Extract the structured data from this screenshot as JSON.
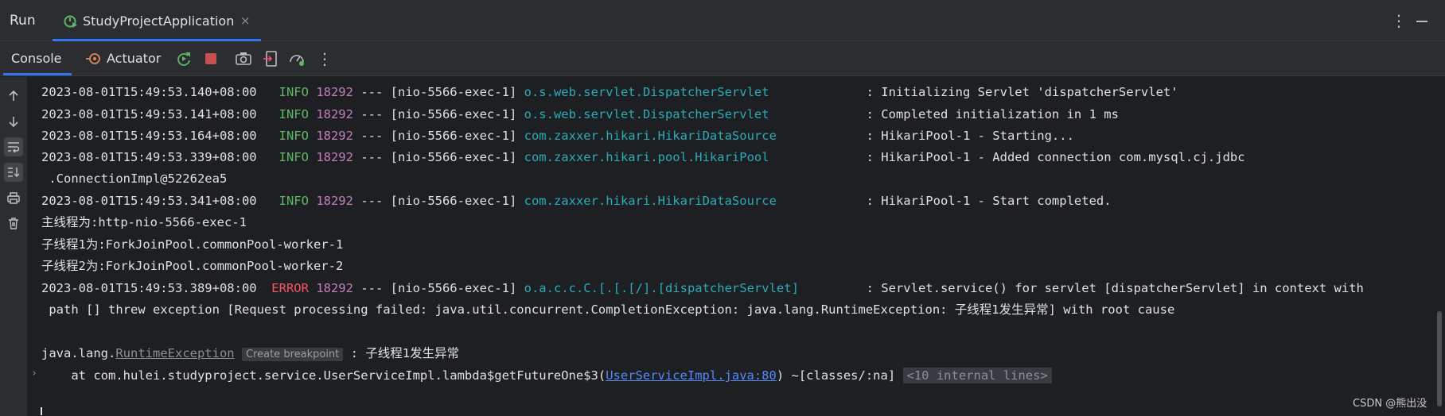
{
  "window": {
    "title": "Run",
    "tab": {
      "label": "StudyProjectApplication",
      "close": "×"
    },
    "more": "⋮"
  },
  "toolbar": {
    "console_label": "Console",
    "actuator_label": "Actuator",
    "more": "⋮"
  },
  "console": {
    "lines": [
      {
        "ts": "2023-08-01T15:49:53.140+08:00",
        "level": " INFO",
        "pid": "18292",
        "sep": " --- ",
        "thread": "[nio-5566-exec-1]",
        "logger": "o.s.web.servlet.DispatcherServlet",
        "msg": ": Initializing Servlet 'dispatcherServlet'"
      },
      {
        "ts": "2023-08-01T15:49:53.141+08:00",
        "level": " INFO",
        "pid": "18292",
        "sep": " --- ",
        "thread": "[nio-5566-exec-1]",
        "logger": "o.s.web.servlet.DispatcherServlet",
        "msg": ": Completed initialization in 1 ms"
      },
      {
        "ts": "2023-08-01T15:49:53.164+08:00",
        "level": " INFO",
        "pid": "18292",
        "sep": " --- ",
        "thread": "[nio-5566-exec-1]",
        "logger": "com.zaxxer.hikari.HikariDataSource",
        "msg": ": HikariPool-1 - Starting..."
      },
      {
        "ts": "2023-08-01T15:49:53.339+08:00",
        "level": " INFO",
        "pid": "18292",
        "sep": " --- ",
        "thread": "[nio-5566-exec-1]",
        "logger": "com.zaxxer.hikari.pool.HikariPool",
        "msg": ": HikariPool-1 - Added connection com.mysql.cj.jdbc"
      },
      {
        "ts": "2023-08-01T15:49:53.341+08:00",
        "level": " INFO",
        "pid": "18292",
        "sep": " --- ",
        "thread": "[nio-5566-exec-1]",
        "logger": "com.zaxxer.hikari.HikariDataSource",
        "msg": ": HikariPool-1 - Start completed."
      }
    ],
    "wrap_line_3": " .ConnectionImpl@52262ea5",
    "plain_1": "主线程为:http-nio-5566-exec-1",
    "plain_2": "子线程1为:ForkJoinPool.commonPool-worker-1",
    "plain_3": "子线程2为:ForkJoinPool.commonPool-worker-2",
    "error_line": {
      "ts": "2023-08-01T15:49:53.389+08:00",
      "level": " ERROR",
      "pid": "18292",
      "sep": " --- ",
      "thread": "[nio-5566-exec-1]",
      "logger": "o.a.c.c.C.[.[.[/].[dispatcherServlet]",
      "msg": ": Servlet.service() for servlet [dispatcherServlet] in context with",
      "wrap": " path [] threw exception [Request processing failed: java.util.concurrent.CompletionException: java.lang.RuntimeException: 子线程1发生异常] with root cause"
    },
    "exception": {
      "prefix": "java.lang.",
      "class_link": "RuntimeException",
      "badge": "Create breakpoint",
      "suffix": " : 子线程1发生异常"
    },
    "stack": {
      "at": "    at com.hulei.studyproject.service.UserServiceImpl.lambda$getFutureOne$3(",
      "link": "UserServiceImpl.java:80",
      "after": ") ~[classes/:na] ",
      "internal": "<10 internal lines>",
      "expand": "›"
    }
  },
  "watermark": "CSDN @熊出没"
}
